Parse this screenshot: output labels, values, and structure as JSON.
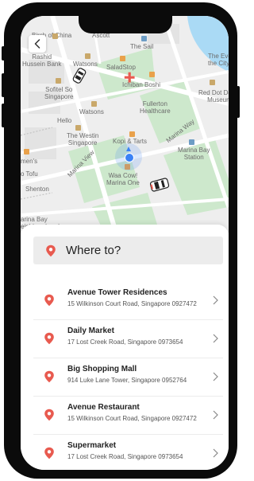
{
  "map": {
    "labels": {
      "birch_of_china": "Birch of China",
      "ascott": "Ascott",
      "the_sail": "The Sail",
      "rashid_hussein_bank": "Rashid\nHussein Bank",
      "watsons_top": "Watsons",
      "saladstop": "SaladStop",
      "the_evolve": "The Eve\nthe City",
      "sofitel": "Sofitel So\nSingapore",
      "ichiban_boshi": "Ichiban Boshi",
      "red_dot": "Red Dot De\nMuseum",
      "hello": "Hello",
      "watsons_mid": "Watsons",
      "fullerton": "Fullerton\nHealthcare",
      "westin": "The Westin\nSingapore",
      "kopi_tarts": "Kopi & Tarts",
      "marina_bay_station": "Marina Bay\nStation",
      "mens": "men's",
      "to_tofu": "o Tofu",
      "waa_cow": "Waa Cow!\nMarina One",
      "shenton": "Shenton",
      "marina_bay_neighbourhood": "arina Bay\neighbourhood",
      "road_marina_way": "Marina Way",
      "road_marina_view": "Marina View"
    }
  },
  "search": {
    "placeholder": "Where to?"
  },
  "places": [
    {
      "name": "Avenue Tower Residences",
      "address": "15 Wilkinson Court Road, Singapore 0927472"
    },
    {
      "name": "Daily Market",
      "address": "17 Lost Creek Road, Singapore 0973654"
    },
    {
      "name": "Big Shopping Mall",
      "address": "914 Luke Lane Tower, Singapore 0952764"
    },
    {
      "name": "Avenue Restaurant",
      "address": "15 Wilkinson Court Road, Singapore 0927472"
    },
    {
      "name": "Supermarket",
      "address": "17 Lost Creek Road, Singapore 0973654"
    }
  ],
  "colors": {
    "accent": "#e85a4f",
    "map_land": "#eeeeee",
    "map_park": "#cde8cc",
    "map_water": "#aadaf5",
    "map_block": "#e3e3e3"
  }
}
